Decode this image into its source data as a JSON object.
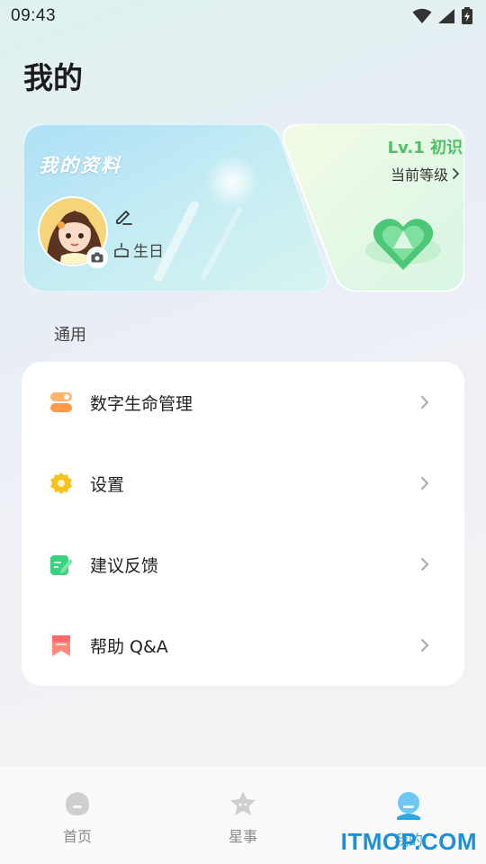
{
  "status_bar": {
    "time": "09:43",
    "icons": [
      "wifi-icon",
      "signal-icon",
      "battery-charging-icon"
    ]
  },
  "page": {
    "title": "我的"
  },
  "profile_card": {
    "title": "我的资料",
    "birthday_label": "生日",
    "icons": [
      "edit-icon",
      "camera-icon",
      "cake-icon"
    ]
  },
  "level_card": {
    "level": "Lv.1 初识",
    "current_level_link": "当前等级",
    "icons": [
      "chevron-right-icon",
      "heart-badge-icon"
    ]
  },
  "section": {
    "label": "通用"
  },
  "menu": {
    "items": [
      {
        "label": "数字生命管理",
        "icon": "toggle-icon",
        "color": "#ff9a4a"
      },
      {
        "label": "设置",
        "icon": "gear-icon",
        "color": "#f7c21a"
      },
      {
        "label": "建议反馈",
        "icon": "feedback-icon",
        "color": "#38d37f"
      },
      {
        "label": "帮助 Q&A",
        "icon": "bookmark-icon",
        "color": "#ff6b6b"
      }
    ]
  },
  "bottom_nav": {
    "items": [
      {
        "label": "首页",
        "icon": "home-icon",
        "active": false
      },
      {
        "label": "星事",
        "icon": "star-icon",
        "active": false
      },
      {
        "label": "我的",
        "icon": "profile-icon",
        "active": true
      }
    ]
  },
  "watermark": "ITMOP.COM",
  "colors": {
    "accent": "#2fa6e0",
    "level_green": "#4fbf68"
  }
}
